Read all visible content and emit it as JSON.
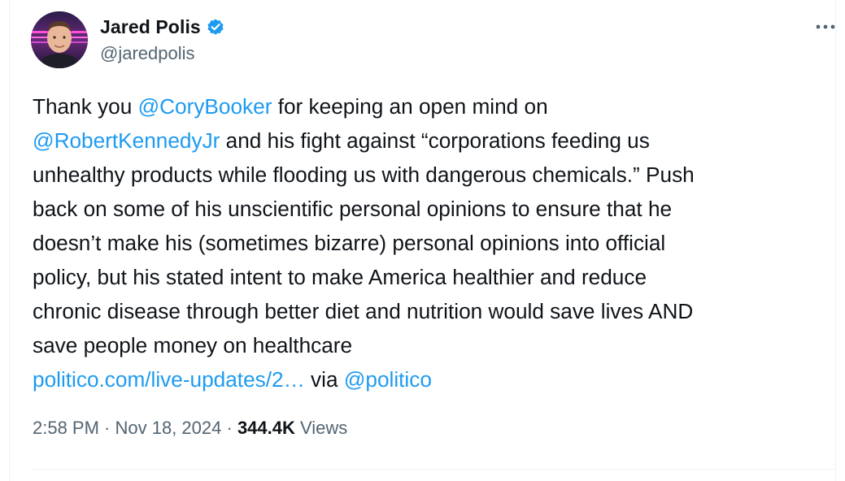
{
  "author": {
    "display_name": "Jared Polis",
    "handle": "@jaredpolis",
    "verified": true
  },
  "tweet": {
    "segments": [
      {
        "type": "text",
        "text": "Thank you "
      },
      {
        "type": "mention",
        "text": "@CoryBooker"
      },
      {
        "type": "text",
        "text": " for keeping an open mind on\n"
      },
      {
        "type": "mention",
        "text": "@RobertKennedyJr"
      },
      {
        "type": "text",
        "text": " and his fight against “corporations feeding us\nunhealthy products while flooding us with dangerous chemicals.” Push\nback on some of his unscientific personal opinions to ensure that he\ndoesn’t make his (sometimes bizarre) personal opinions into official\npolicy, but his stated intent to make America healthier and reduce\nchronic disease through better diet and nutrition would save lives AND\nsave people money on healthcare\n"
      },
      {
        "type": "link",
        "text": "politico.com/live-updates/2…"
      },
      {
        "type": "text",
        "text": " via "
      },
      {
        "type": "mention",
        "text": "@politico"
      }
    ]
  },
  "meta": {
    "time": "2:58 PM",
    "separator": " · ",
    "date": "Nov 18, 2024",
    "views_count": "344.4K",
    "views_label": " Views"
  },
  "icons": {
    "verified": "verified-badge-icon",
    "more": "more-options-icon",
    "accent_color": "#1d9bf0"
  }
}
